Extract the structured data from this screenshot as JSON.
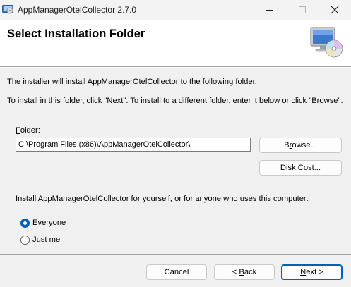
{
  "window": {
    "title": "AppManagerOtelCollector 2.7.0",
    "icons": {
      "app": "installer-icon",
      "minimize": "minimize-icon",
      "maximize": "maximize-icon",
      "close": "close-icon"
    }
  },
  "header": {
    "title": "Select Installation Folder",
    "graphic": "computer-disc-icon"
  },
  "body": {
    "intro_line1": "The installer will install AppManagerOtelCollector to the following folder.",
    "intro_line2": "To install in this folder, click \"Next\". To install to a different folder, enter it below or click \"Browse\".",
    "folder_label_accel": "F",
    "folder_label_rest": "older:",
    "folder_value": "C:\\Program Files (x86)\\AppManagerOtelCollector\\",
    "browse_accel": "r",
    "browse_pre": "B",
    "browse_post": "owse...",
    "diskcost_pre": "Dis",
    "diskcost_accel": "k",
    "diskcost_post": " Cost...",
    "install_for": "Install AppManagerOtelCollector for yourself, or for anyone who uses this computer:",
    "options": [
      {
        "pre": "",
        "accel": "E",
        "post": "veryone",
        "selected": true
      },
      {
        "pre": "Just ",
        "accel": "m",
        "post": "e",
        "selected": false
      }
    ]
  },
  "footer": {
    "cancel": "Cancel",
    "back_pre": "< ",
    "back_accel": "B",
    "back_post": "ack",
    "next_accel": "N",
    "next_post": "ext >"
  },
  "colors": {
    "accent": "#005fb8",
    "header_bg": "#ffffff",
    "dialog_bg": "#f0f0f0"
  }
}
